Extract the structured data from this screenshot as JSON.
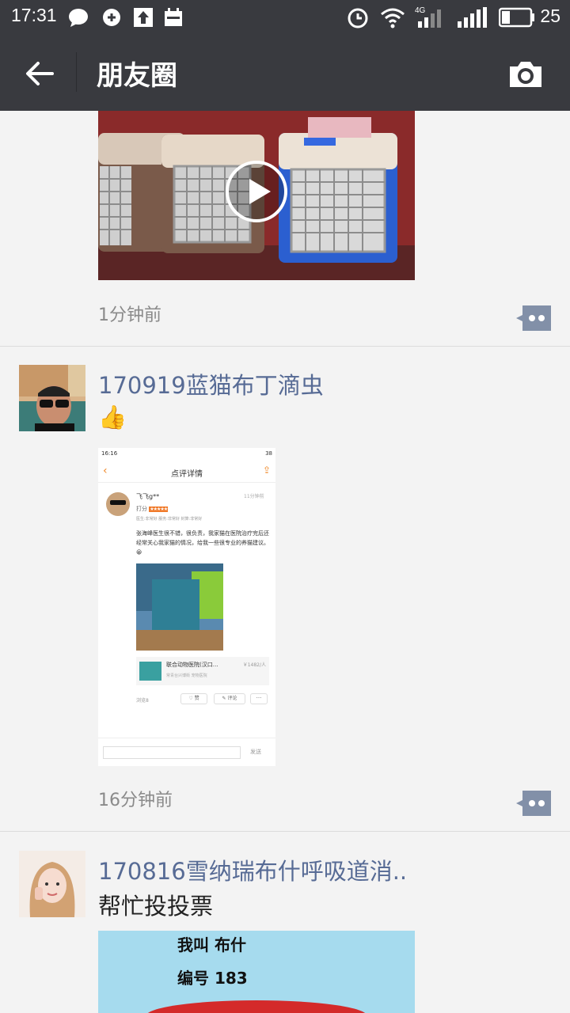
{
  "status_bar": {
    "time": "17:31",
    "battery": "25",
    "network": "4G"
  },
  "header": {
    "title": "朋友圈"
  },
  "posts": [
    {
      "time": "1分钟前"
    },
    {
      "name": "170919蓝猫布丁滴虫",
      "text": "👍",
      "time": "16分钟前",
      "screenshot": {
        "status_time": "16:16",
        "status_battery": "38",
        "title": "点评详情",
        "user": "飞飞g**",
        "rating_label": "打分",
        "time_ago": "11分钟前",
        "sub_ratings": "医生:非常好  服务:非常好  封算:非常好",
        "review": "张海峰医生很不错，很负责，我家猫在医院治疗完后还经常关心我家猫的情况，给我一些很专业的养猫建议。😀",
        "shop_name": "联合动物医院(汉口…",
        "shop_price": "￥1482/人",
        "shop_sub": "常青台兴博街  宠物医院",
        "views": "浏览8",
        "like": "赞",
        "comment": "评论",
        "send": "发送"
      }
    },
    {
      "name": "170816雪纳瑞布什呼吸道消..",
      "text": "帮忙投投票",
      "vote_lines": [
        "我叫  布什",
        "编号  183"
      ]
    }
  ]
}
